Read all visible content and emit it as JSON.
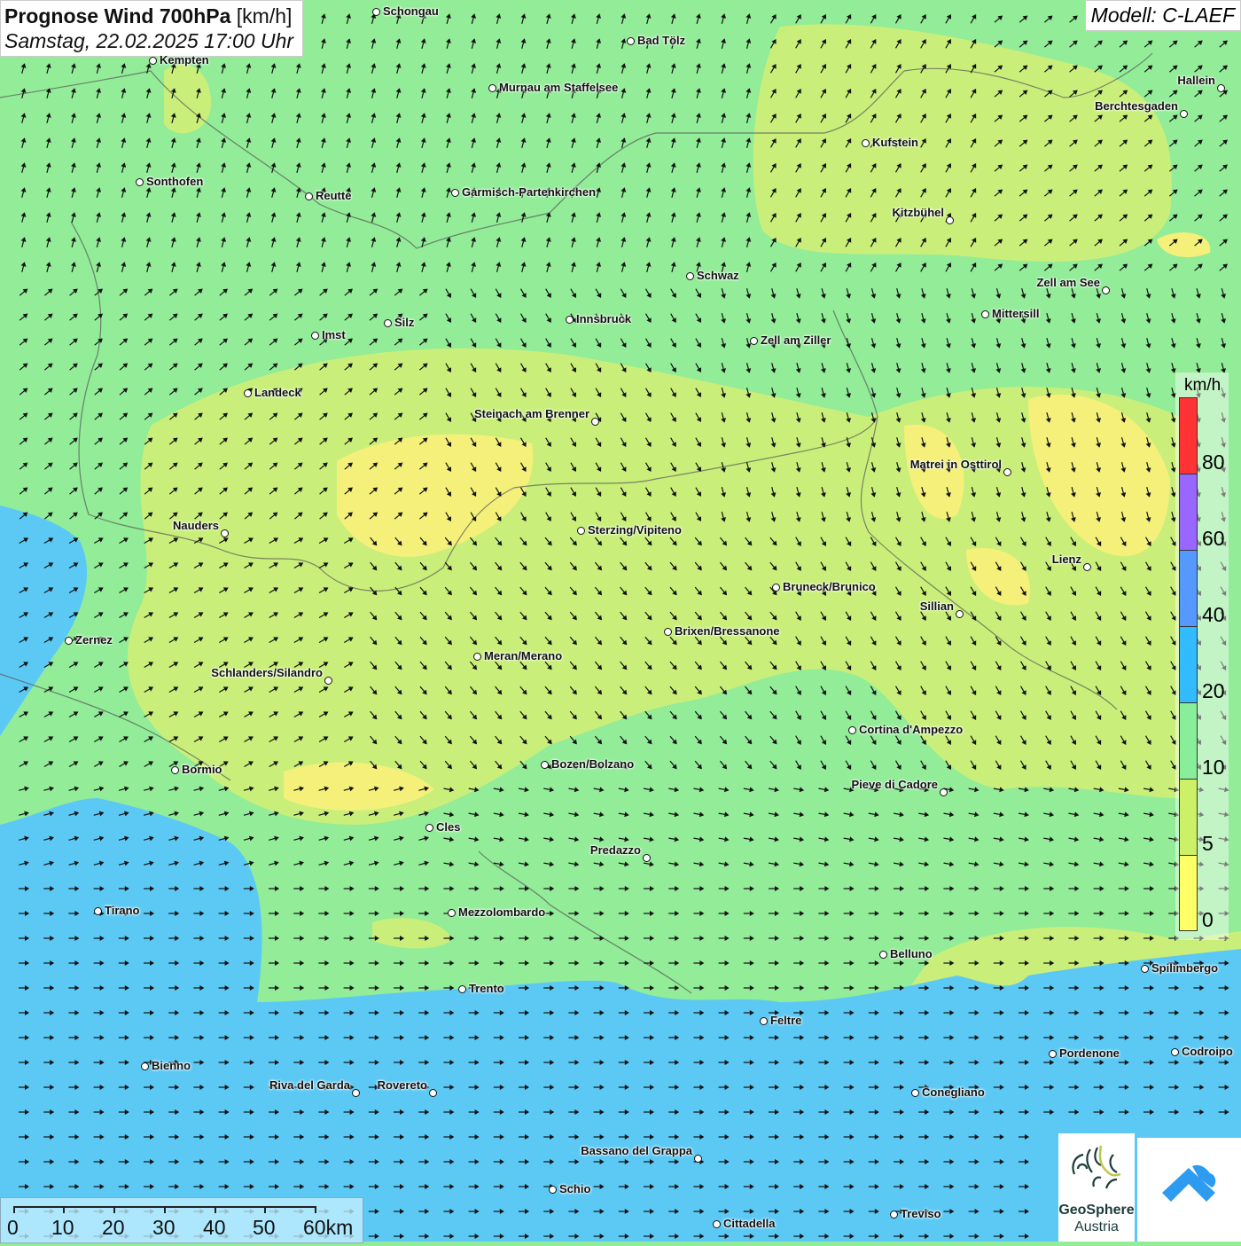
{
  "header": {
    "title": "Prognose Wind 700hPa",
    "unit": "[km/h]",
    "datetime": "Samstag, 22.02.2025 17:00 Uhr",
    "model": "Modell: C-LAEF"
  },
  "legend": {
    "unit": "km/h",
    "labels": [
      "80",
      "60",
      "40",
      "20",
      "10",
      "5",
      "0"
    ],
    "colors": [
      "#ff3333",
      "#9966ff",
      "#5599ff",
      "#33bbff",
      "#88ee99",
      "#ccf066",
      "#ffff66"
    ]
  },
  "scalebar": {
    "labels": [
      "0",
      "10",
      "20",
      "30",
      "40",
      "50",
      "60km"
    ]
  },
  "logos": {
    "geosphere_line1": "GeoSphere",
    "geosphere_line2": "Austria"
  },
  "cities": [
    "Schongau",
    "Bad Tölz",
    "Kempten",
    "Murnau am Staffelsee",
    "Hallein",
    "Berchtesgaden",
    "Kufstein",
    "Sonthofen",
    "Reutte",
    "Garmisch-Partenkirchen",
    "Kitzbühel",
    "Schwaz",
    "Zell am See",
    "Mittersill",
    "Innsbruck",
    "Silz",
    "Imst",
    "Zell am Ziller",
    "Landeck",
    "Steinach am Brenner",
    "Matrei in Osttirol",
    "Nauders",
    "Sterzing/Vipiteno",
    "Lienz",
    "Bruneck/Brunico",
    "Sillian",
    "Brixen/Bressanone",
    "Zernez",
    "Meran/Merano",
    "Schlanders/Silandro",
    "Cortina d'Ampezzo",
    "Bozen/Bolzano",
    "Bormio",
    "Pieve di Cadore",
    "Cles",
    "Predazzo",
    "Tirano",
    "Mezzolombardo",
    "Belluno",
    "Spilimbergo",
    "Trento",
    "Feltre",
    "Pordenone",
    "Codroipo",
    "Bienno",
    "Riva del Garda",
    "Rovereto",
    "Conegliano",
    "Bassano del Grappa",
    "Schio",
    "Treviso",
    "Cittadella"
  ],
  "colors": {
    "wind_5_10": "#ccf066",
    "wind_0_5": "#f5f070",
    "wind_10_20": "#92ec98",
    "wind_20_40": "#5cc9f5"
  }
}
